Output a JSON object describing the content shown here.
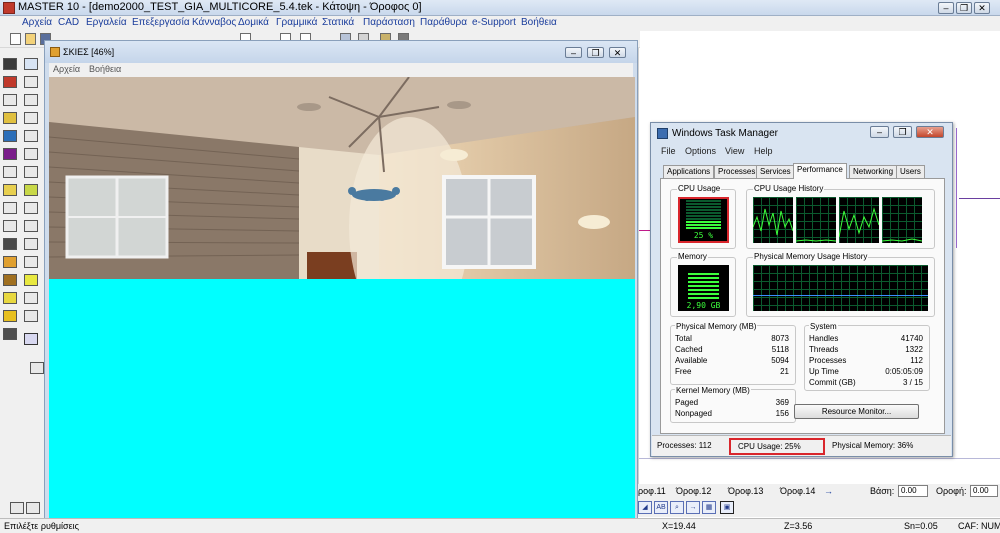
{
  "main_window": {
    "title": "MASTER 10 - [demo2000_TEST_GIA_MULTICORE_5.4.tek - Κάτοψη - Όροφος 0]"
  },
  "menu": [
    "Αρχεία",
    "CAD",
    "Εργαλεία",
    "Επεξεργασία",
    "Κάνναβος",
    "Δομικά",
    "Γραμμικά",
    "Στατικά",
    "Παράσταση",
    "Παράθυρα",
    "e-Support",
    "Βοήθεια"
  ],
  "render_window": {
    "title": "ΣΚΙΕΣ [46%]",
    "menu": [
      "Αρχεία",
      "Βοήθεια"
    ]
  },
  "task_manager": {
    "title": "Windows Task Manager",
    "menu": [
      "File",
      "Options",
      "View",
      "Help"
    ],
    "tabs": [
      "Applications",
      "Processes",
      "Services",
      "Performance",
      "Networking",
      "Users"
    ],
    "active_tab": "Performance",
    "cpu_usage": {
      "title": "CPU Usage",
      "value": "25 %",
      "fraction": 0.25
    },
    "cpu_history": {
      "title": "CPU Usage History"
    },
    "memory": {
      "title": "Memory",
      "value": "2,90 GB"
    },
    "memory_history": {
      "title": "Physical Memory Usage History"
    },
    "physical_memory": {
      "title": "Physical Memory (MB)",
      "rows": [
        {
          "label": "Total",
          "value": "8073"
        },
        {
          "label": "Cached",
          "value": "5118"
        },
        {
          "label": "Available",
          "value": "5094"
        },
        {
          "label": "Free",
          "value": "21"
        }
      ]
    },
    "kernel_memory": {
      "title": "Kernel Memory (MB)",
      "rows": [
        {
          "label": "Paged",
          "value": "369"
        },
        {
          "label": "Nonpaged",
          "value": "156"
        }
      ]
    },
    "system": {
      "title": "System",
      "rows": [
        {
          "label": "Handles",
          "value": "41740"
        },
        {
          "label": "Threads",
          "value": "1322"
        },
        {
          "label": "Processes",
          "value": "112"
        },
        {
          "label": "Up Time",
          "value": "0:05:05:09"
        },
        {
          "label": "Commit (GB)",
          "value": "3 / 15"
        }
      ]
    },
    "resource_monitor_button": "Resource Monitor...",
    "status": {
      "processes": "Processes: 112",
      "cpu": "CPU Usage: 25%",
      "memory": "Physical Memory: 36%"
    }
  },
  "floor_tabs": [
    "ροφ.11",
    "Όροφ.12",
    "Όροφ.13",
    "Όροφ.14"
  ],
  "fields": {
    "base_label": "Βάση:",
    "base_value": "0.00",
    "ceiling_label": "Οροφή:",
    "ceiling_value": "0.00"
  },
  "statusbar": {
    "hint": "Επιλέξτε ρυθμίσεις",
    "x": "X=19.44",
    "z": "Z=3.56",
    "sn": "Sn=0.05",
    "caps": "CAF: NUM"
  },
  "colors": {
    "cyan_fill": "#00ffff",
    "highlight_red": "#d9262c",
    "meter_green": "#3cff3c"
  }
}
